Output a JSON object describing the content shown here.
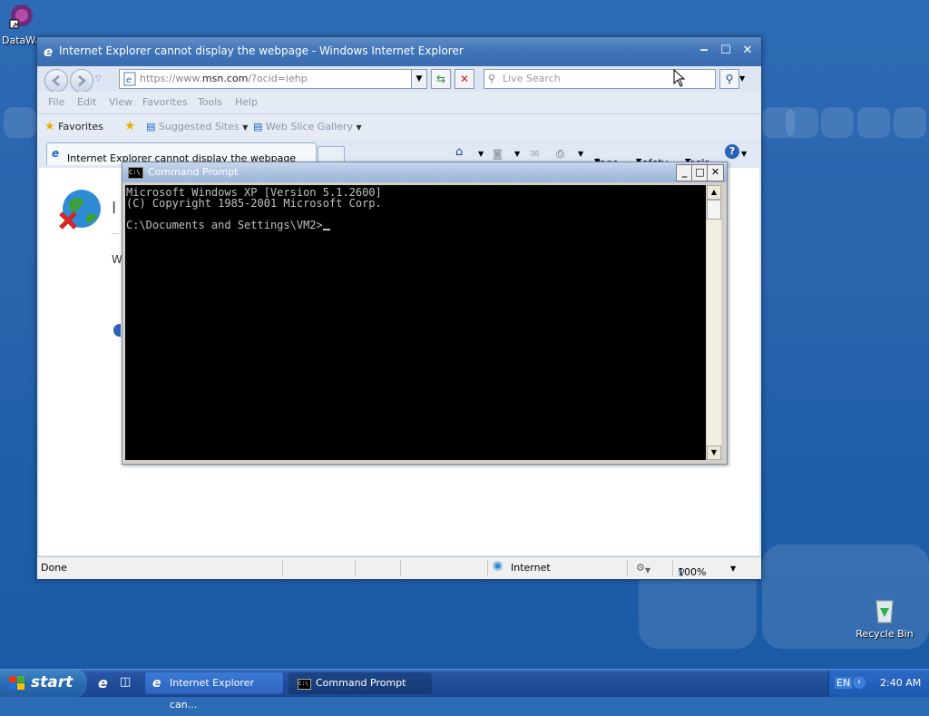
{
  "desktop": {
    "icon_top_left_label": "DataWa",
    "recycle_bin_label": "Recycle Bin"
  },
  "ie": {
    "title": "Internet Explorer cannot display the webpage - Windows Internet Explorer",
    "address_prefix": "https://www.",
    "address_host": "msn.com",
    "address_suffix": "/?ocid=iehp",
    "search_placeholder": "Live Search",
    "menu": [
      "File",
      "Edit",
      "View",
      "Favorites",
      "Tools",
      "Help"
    ],
    "favorites_label": "Favorites",
    "suggested_sites": "Suggested Sites",
    "web_slice_gallery": "Web Slice Gallery",
    "tab_title": "Internet Explorer cannot display the webpage",
    "command_bar": {
      "page": "Page",
      "safety": "Safety",
      "tools": "Tools"
    },
    "content_heading": "I",
    "content_text": "W",
    "status": {
      "text": "Done",
      "zone": "Internet",
      "zoom": "100%"
    }
  },
  "cmd": {
    "title": "Command Prompt",
    "icon_text": "C:\\",
    "lines": [
      "Microsoft Windows XP [Version 5.1.2600]",
      "(C) Copyright 1985-2001 Microsoft Corp.",
      "",
      "C:\\Documents and Settings\\VM2>"
    ]
  },
  "taskbar": {
    "start_label": "start",
    "tasks": [
      {
        "label": "Internet Explorer can..."
      },
      {
        "label": "Command Prompt"
      }
    ],
    "language": "EN",
    "time": "2:40 AM"
  },
  "colors": {
    "desktop": "#2a64ad",
    "ie_title": "#3f74b8",
    "cmd_bg": "#000000",
    "cmd_text": "#c0c0c0",
    "taskbar": "#1f4d9a"
  }
}
